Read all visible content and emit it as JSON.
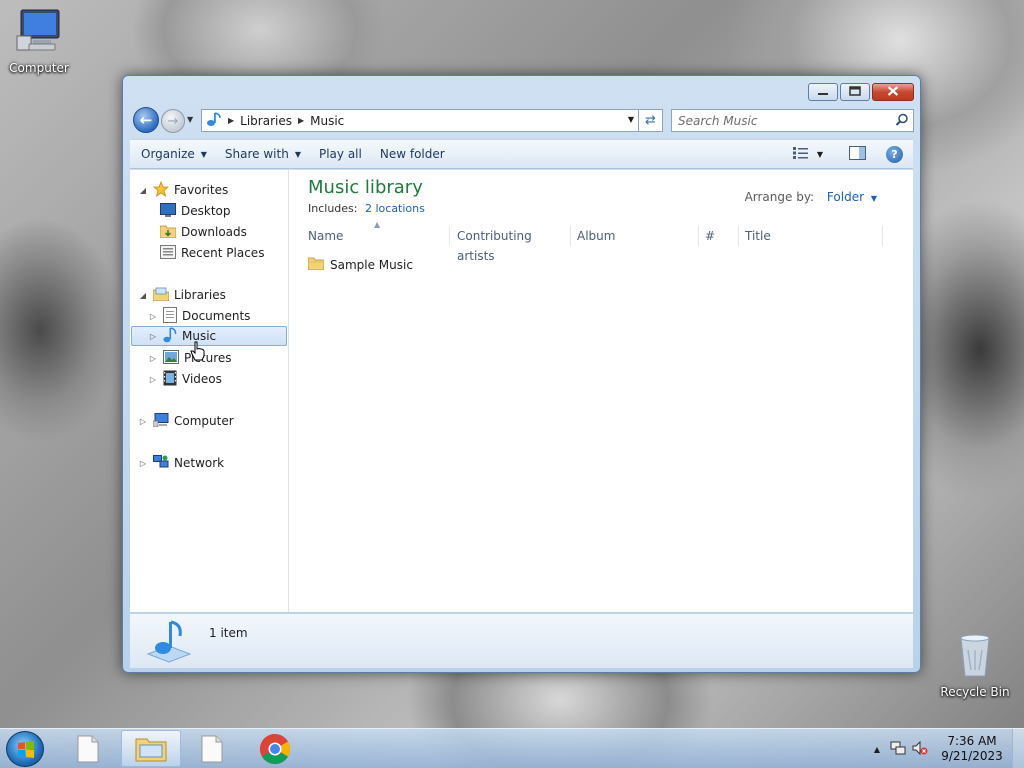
{
  "desktop": {
    "computer_label": "Computer",
    "recycle_bin_label": "Recycle Bin"
  },
  "window": {
    "address": {
      "segments": [
        "Libraries",
        "Music"
      ]
    },
    "search": {
      "placeholder": "Search Music"
    },
    "toolbar": {
      "organize": "Organize",
      "share_with": "Share with",
      "play_all": "Play all",
      "new_folder": "New folder"
    },
    "nav": {
      "favorites": "Favorites",
      "desktop": "Desktop",
      "downloads": "Downloads",
      "recent_places": "Recent Places",
      "libraries": "Libraries",
      "documents": "Documents",
      "music": "Music",
      "pictures": "Pictures",
      "videos": "Videos",
      "computer": "Computer",
      "network": "Network"
    },
    "library": {
      "title": "Music library",
      "includes_label": "Includes:",
      "locations_link": "2 locations",
      "arrange_label": "Arrange by:",
      "arrange_value": "Folder"
    },
    "columns": [
      "Name",
      "Contributing artists",
      "Album",
      "#",
      "Title"
    ],
    "files": [
      {
        "name": "Sample Music",
        "type": "folder"
      }
    ],
    "details": {
      "count": "1 item"
    }
  },
  "taskbar": {
    "time": "7:36 AM",
    "date": "9/21/2023"
  },
  "colors": {
    "library_title": "#1e7c3a",
    "link": "#1a63b8",
    "selection": "#cfe1f7"
  }
}
